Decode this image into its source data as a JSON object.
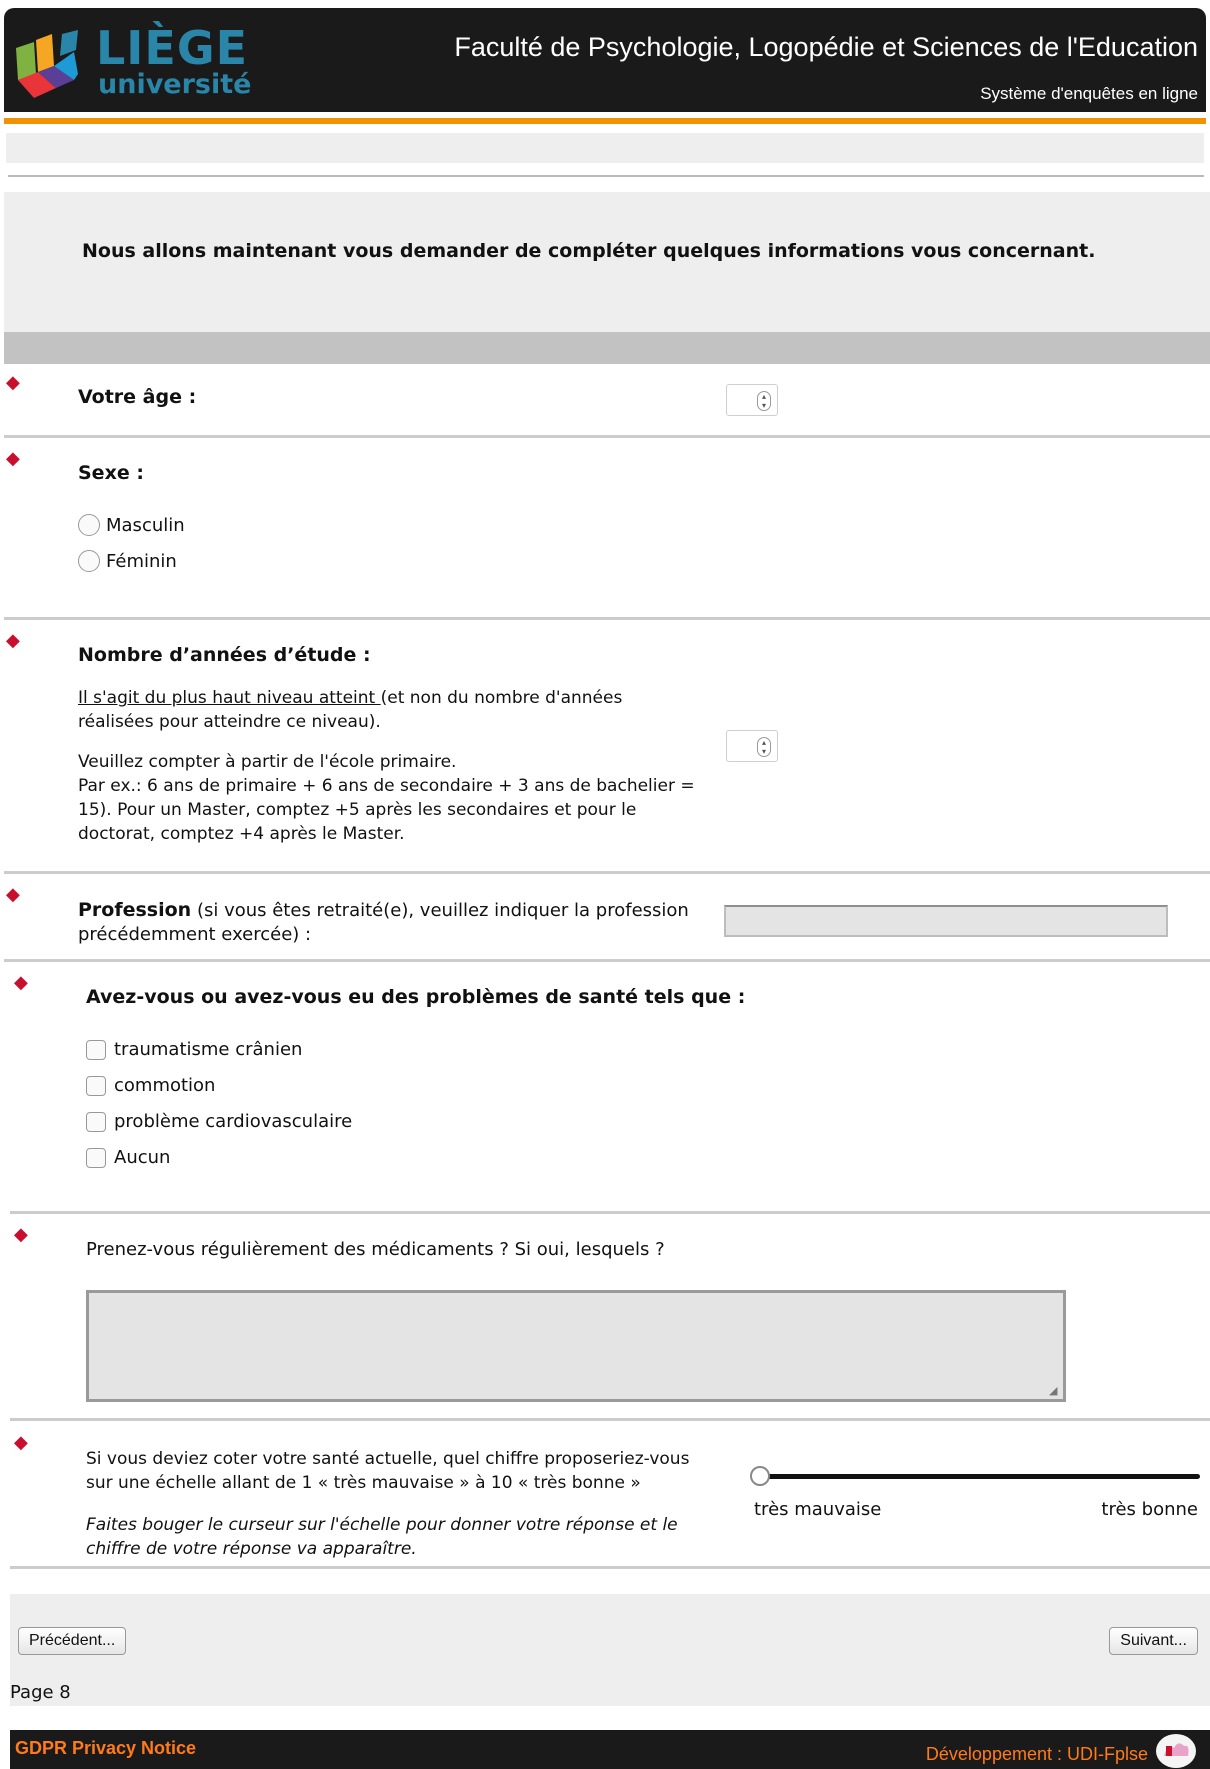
{
  "header": {
    "logo_main": "LIÈGE",
    "logo_sub": "université",
    "faculty_title": "Faculté de Psychologie, Logopédie et Sciences de l'Education",
    "system_subtitle": "Système d'enquêtes en ligne",
    "brand_colors": {
      "accent_orange": "#f39200",
      "logo_blue": "#2a86a8",
      "required_red": "#c8102e"
    }
  },
  "intro": {
    "text": "Nous allons maintenant vous demander de compléter quelques informations vous concernant."
  },
  "questions": {
    "age": {
      "required_marker": "◆",
      "label": "Votre âge :"
    },
    "sex": {
      "required_marker": "◆",
      "label": "Sexe :",
      "options": [
        "Masculin",
        "Féminin"
      ]
    },
    "study_years": {
      "required_marker": "◆",
      "label": "Nombre d’années d’étude :",
      "note_underlined": "Il s'agit du plus haut niveau atteint ",
      "note_rest": "(et non du nombre d'années réalisées pour atteindre ce niveau).",
      "instructions": [
        "Veuillez compter à partir de l'école primaire.",
        "Par ex.: 6 ans de primaire + 6 ans de secondaire + 3 ans de bachelier = 15). Pour un Master, comptez +5 après les secondaires et pour le doctorat, comptez +4 après le Master."
      ]
    },
    "profession": {
      "required_marker": "◆",
      "label_bold": "Profession",
      "label_rest": " (si vous êtes retraité(e), veuillez indiquer la profession précédemment exercée) :",
      "value": ""
    },
    "health": {
      "required_marker": "◆",
      "label": "Avez-vous ou avez-vous eu des problèmes de santé tels que :",
      "options": [
        "traumatisme crânien",
        "commotion",
        "problème cardiovasculaire",
        "Aucun"
      ]
    },
    "medication": {
      "required_marker": "◆",
      "label": "Prenez-vous régulièrement des médicaments ? Si oui, lesquels ?",
      "value": ""
    },
    "health_scale": {
      "required_marker": "◆",
      "label": "Si vous deviez coter votre santé actuelle, quel chiffre proposeriez-vous sur une échelle allant de 1 « très mauvaise » à 10 « très bonne »",
      "hint": "Faites bouger le curseur sur l'échelle pour donner votre réponse et le chiffre de votre réponse va apparaître.",
      "min_label": "très mauvaise",
      "max_label": "très bonne"
    }
  },
  "navigation": {
    "prev_label": "Précédent...",
    "next_label": "Suivant...",
    "page_label": "Page 8"
  },
  "footer": {
    "gdpr_label": "GDPR Privacy Notice",
    "dev_label": "Développement : UDI-Fplse"
  }
}
